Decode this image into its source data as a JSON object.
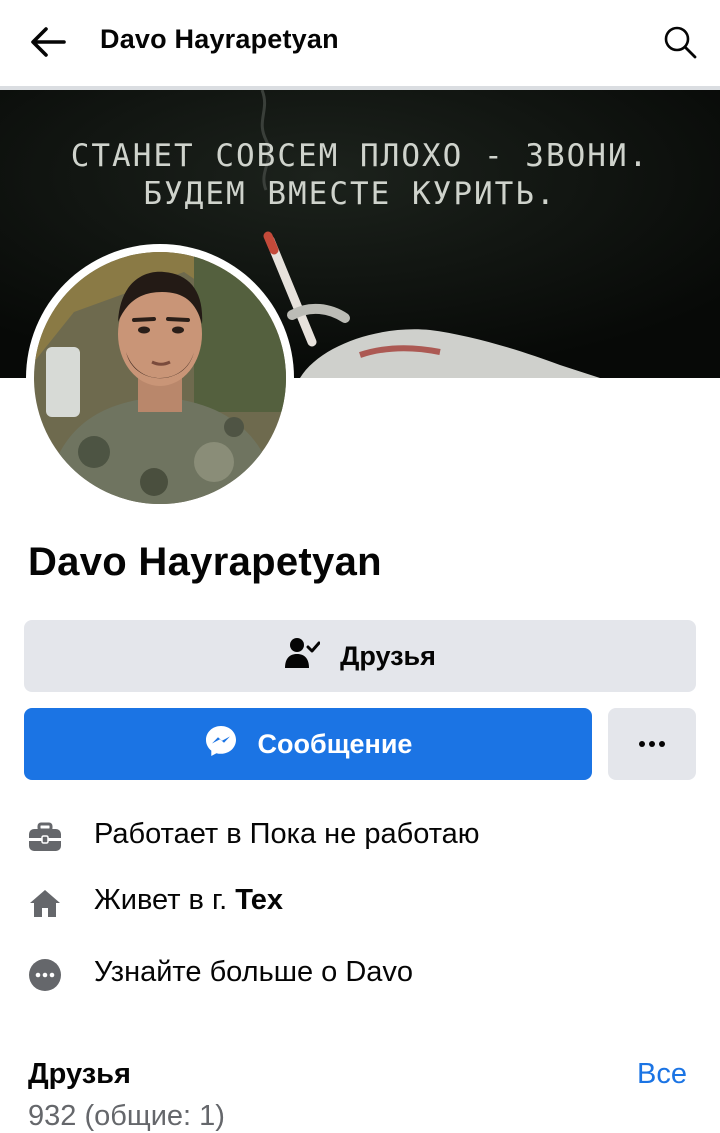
{
  "header": {
    "title": "Davo Hayrapetyan",
    "back_icon": "arrow-left-icon",
    "search_icon": "search-icon"
  },
  "cover": {
    "line1": "СТАНЕТ СОВСЕМ ПЛОХО - ЗВОНИ.",
    "line2": "БУДЕМ ВМЕСТЕ КУРИТЬ."
  },
  "profile": {
    "name": "Davo Hayrapetyan"
  },
  "actions": {
    "friends_label": "Друзья",
    "friends_icon": "friend-check-icon",
    "message_label": "Сообщение",
    "message_icon": "messenger-icon",
    "more_label": "•••"
  },
  "intro": {
    "work_prefix": "Работает в Пока не работаю",
    "work_icon": "briefcase-icon",
    "home_prefix": "Живет в г. ",
    "home_city": "Tex",
    "home_icon": "home-icon",
    "more_label": "Узнайте больше о Davo",
    "more_icon": "more-dots-icon"
  },
  "friends": {
    "title": "Друзья",
    "see_all": "Все",
    "count": "932 (общие: 1)"
  },
  "colors": {
    "accent": "#1b74e4",
    "button_gray": "#e4e6eb",
    "secondary_text": "#65676b"
  }
}
